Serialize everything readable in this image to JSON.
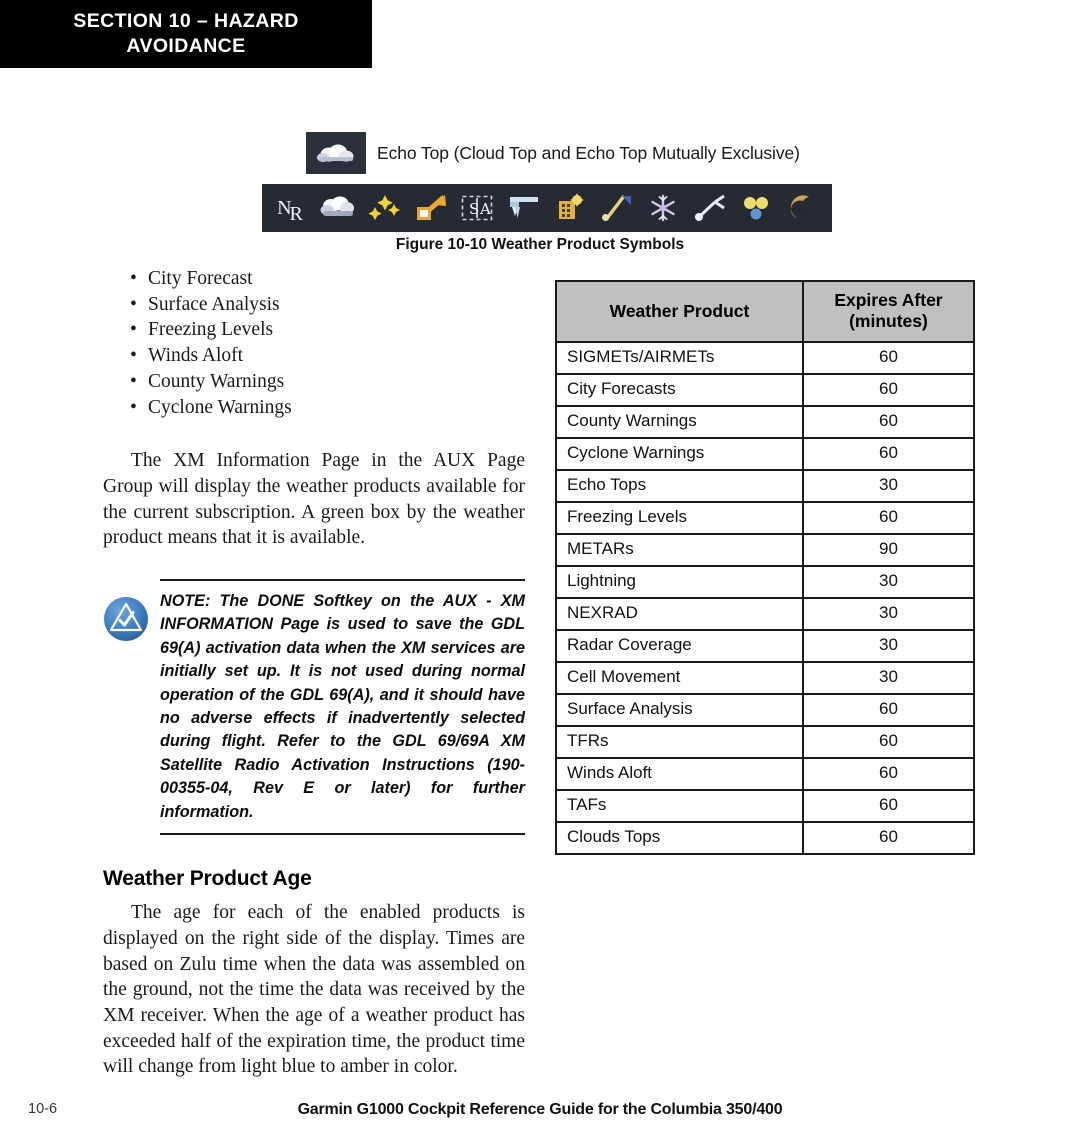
{
  "section_header": {
    "text": "SECTION 10 – HAZARD\nAVOIDANCE"
  },
  "figure": {
    "echo_top_legend": {
      "icon": "cloud-icon",
      "label": "Echo Top (Cloud Top and Echo Top Mutually Exclusive)"
    },
    "symbol_strip": {
      "background_color": "#262b33",
      "symbols": [
        "nexrad-nr-icon",
        "cloud-tops-icon",
        "lightning-icon",
        "cell-movement-icon",
        "sigmet-airmet-icon",
        "freezing-level-icon",
        "city-forecast-icon",
        "winds-aloft-icon",
        "snowflake-icon",
        "surface-analysis-icon",
        "county-warnings-icon",
        "cyclone-warnings-icon"
      ]
    },
    "caption": "Figure 10-10  Weather Product Symbols"
  },
  "bullets": [
    "City Forecast",
    "Surface Analysis",
    "Freezing Levels",
    "Winds Aloft",
    "County Warnings",
    "Cyclone Warnings"
  ],
  "paragraphs": {
    "xm_info": "The XM Information Page in the AUX Page Group will display the weather products available for the current subscription.  A green box by the weather product means that it is available.",
    "product_age": "The age for each of the enabled products is displayed on the right side of the display.  Times are based on Zulu time when the data was assembled on the ground, not the time the data was received by the XM receiver.  When the age of a weather product has exceeded half of the expiration time, the product time will change from light blue to amber in color."
  },
  "note": {
    "label": "NOTE:",
    "icon": "note-triangle-check-icon",
    "icon_color": "#3f7fc1",
    "text": " The DONE Softkey on the AUX - XM INFORMATION Page is used to save the GDL 69(A) activation data when the XM services are initially set up.  It is not used during normal operation of the GDL 69(A), and it should have no adverse effects if inadvertently selected during flight.  Refer to the GDL 69/69A XM Satellite Radio Activation Instructions (190-00355-04, Rev E or later) for further information."
  },
  "sub_heading": "Weather Product Age",
  "table": {
    "header_background": "#c0c0c0",
    "columns": [
      "Weather Product",
      "Expires After\n(minutes)"
    ],
    "column_labels": {
      "product": "Weather Product",
      "expires_line1": "Expires After",
      "expires_line2": "(minutes)"
    },
    "rows": [
      {
        "product": "SIGMETs/AIRMETs",
        "expires": "60"
      },
      {
        "product": "City Forecasts",
        "expires": "60"
      },
      {
        "product": "County Warnings",
        "expires": "60"
      },
      {
        "product": "Cyclone Warnings",
        "expires": "60"
      },
      {
        "product": "Echo Tops",
        "expires": "30"
      },
      {
        "product": "Freezing Levels",
        "expires": "60"
      },
      {
        "product": "METARs",
        "expires": "90"
      },
      {
        "product": "Lightning",
        "expires": "30"
      },
      {
        "product": "NEXRAD",
        "expires": "30"
      },
      {
        "product": "Radar Coverage",
        "expires": "30"
      },
      {
        "product": "Cell Movement",
        "expires": "30"
      },
      {
        "product": "Surface Analysis",
        "expires": "60"
      },
      {
        "product": "TFRs",
        "expires": "60"
      },
      {
        "product": "Winds Aloft",
        "expires": "60"
      },
      {
        "product": "TAFs",
        "expires": "60"
      },
      {
        "product": "Clouds Tops",
        "expires": "60"
      }
    ]
  },
  "footer": {
    "page_number": "10-6",
    "title": "Garmin G1000 Cockpit Reference Guide for the Columbia 350/400"
  }
}
